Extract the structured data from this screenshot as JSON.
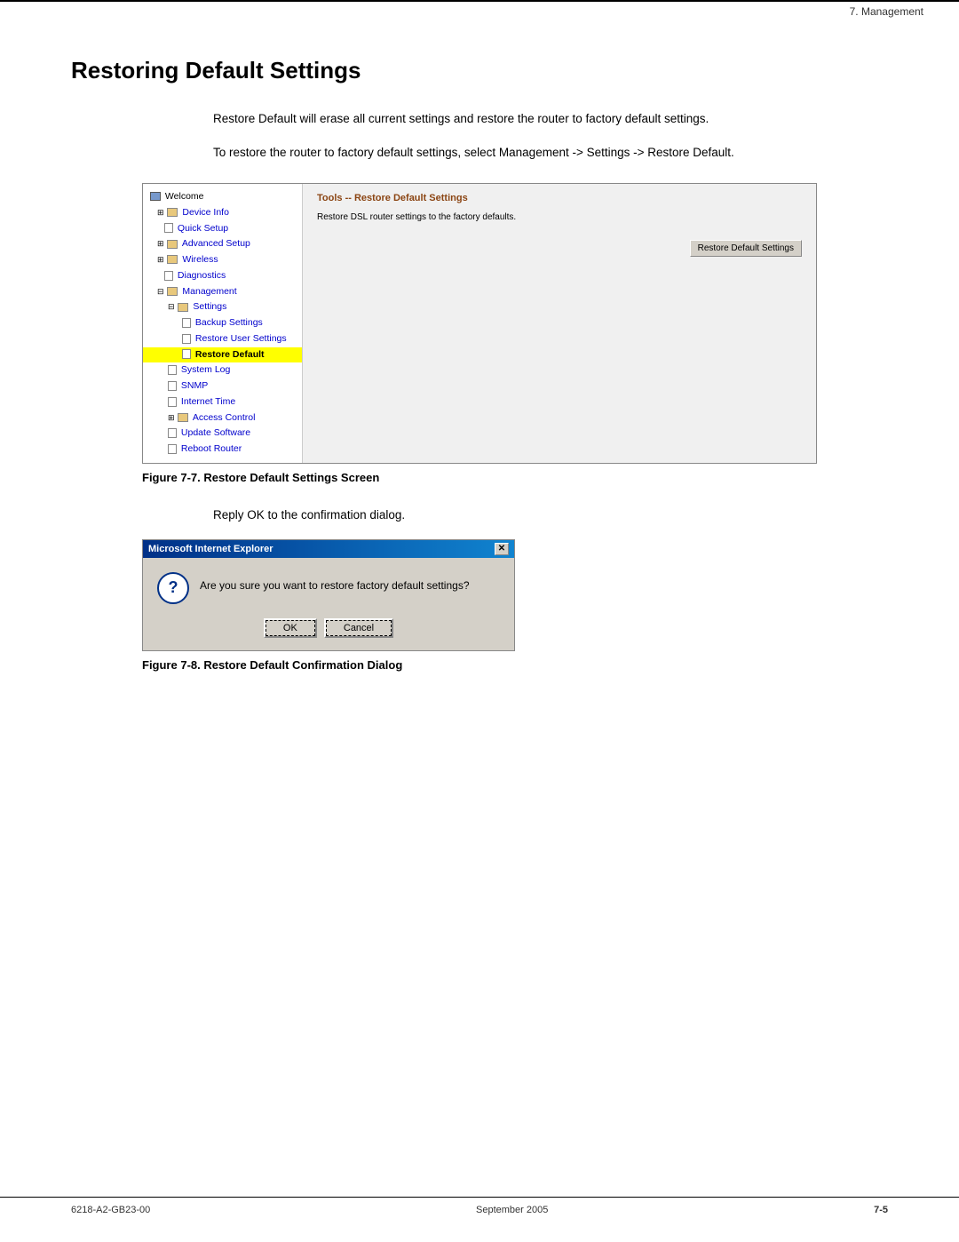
{
  "header": {
    "section": "7. Management"
  },
  "page": {
    "title": "Restoring Default Settings",
    "para1": "Restore Default will erase all current settings and restore the router to factory default settings.",
    "para2": "To restore the router to factory default settings, select Management -> Settings -> Restore Default."
  },
  "router_ui": {
    "sidebar": {
      "items": [
        {
          "label": "Welcome",
          "indent": 0,
          "type": "monitor"
        },
        {
          "label": "Device Info",
          "indent": 1,
          "type": "folder",
          "expand": "plus"
        },
        {
          "label": "Quick Setup",
          "indent": 1,
          "type": "page"
        },
        {
          "label": "Advanced Setup",
          "indent": 1,
          "type": "folder",
          "expand": "plus"
        },
        {
          "label": "Wireless",
          "indent": 1,
          "type": "folder",
          "expand": "plus"
        },
        {
          "label": "Diagnostics",
          "indent": 1,
          "type": "page"
        },
        {
          "label": "Management",
          "indent": 1,
          "type": "folder",
          "expand": "minus"
        },
        {
          "label": "Settings",
          "indent": 2,
          "type": "folder",
          "expand": "minus"
        },
        {
          "label": "Backup Settings",
          "indent": 3,
          "type": "page"
        },
        {
          "label": "Restore User Settings",
          "indent": 3,
          "type": "page"
        },
        {
          "label": "Restore Default",
          "indent": 3,
          "type": "page",
          "highlight": true
        },
        {
          "label": "System Log",
          "indent": 2,
          "type": "page"
        },
        {
          "label": "SNMP",
          "indent": 2,
          "type": "page"
        },
        {
          "label": "Internet Time",
          "indent": 2,
          "type": "page"
        },
        {
          "label": "Access Control",
          "indent": 2,
          "type": "folder",
          "expand": "plus"
        },
        {
          "label": "Update Software",
          "indent": 2,
          "type": "page"
        },
        {
          "label": "Reboot Router",
          "indent": 2,
          "type": "page"
        }
      ]
    },
    "main": {
      "title": "Tools -- Restore Default Settings",
      "description": "Restore DSL router settings to the factory defaults.",
      "button_label": "Restore Default Settings"
    }
  },
  "figure1": {
    "caption": "Figure 7-7.    Restore Default Settings Screen"
  },
  "reply_text": "Reply OK to the confirmation dialog.",
  "dialog": {
    "title": "Microsoft Internet Explorer",
    "close_label": "✕",
    "icon_label": "?",
    "message": "Are you sure you want to restore factory default settings?",
    "ok_label": "OK",
    "cancel_label": "Cancel"
  },
  "figure2": {
    "caption": "Figure 7-8.    Restore Default Confirmation Dialog"
  },
  "footer": {
    "left": "6218-A2-GB23-00",
    "center": "September 2005",
    "right": "7-5"
  }
}
